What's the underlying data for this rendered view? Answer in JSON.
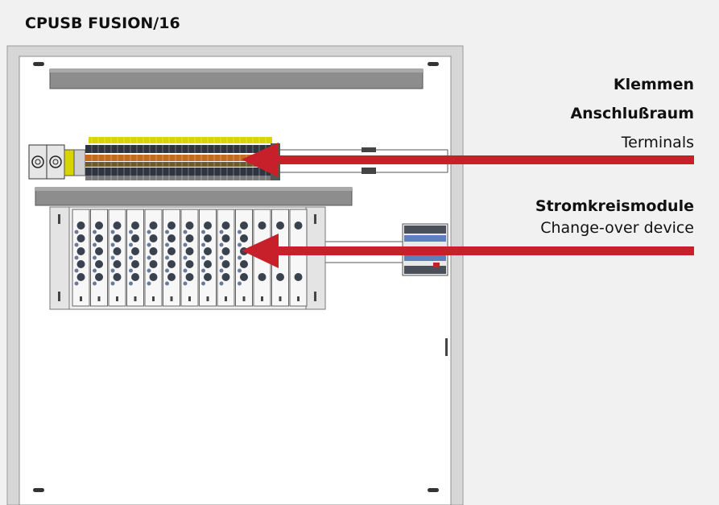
{
  "title": "CPUSB FUSION/16",
  "labels": {
    "terminals_heading_line1": "Klemmen",
    "terminals_heading_line2": "Anschlußraum",
    "terminals_sub": "Terminals",
    "modules_heading": "Stromkreismodule",
    "modules_sub": "Change-over device"
  },
  "colors": {
    "arrow": "#c8202a",
    "panel": "#ffffff",
    "cabinet": "#d9d9d9",
    "rail": "#8a8a8a"
  }
}
